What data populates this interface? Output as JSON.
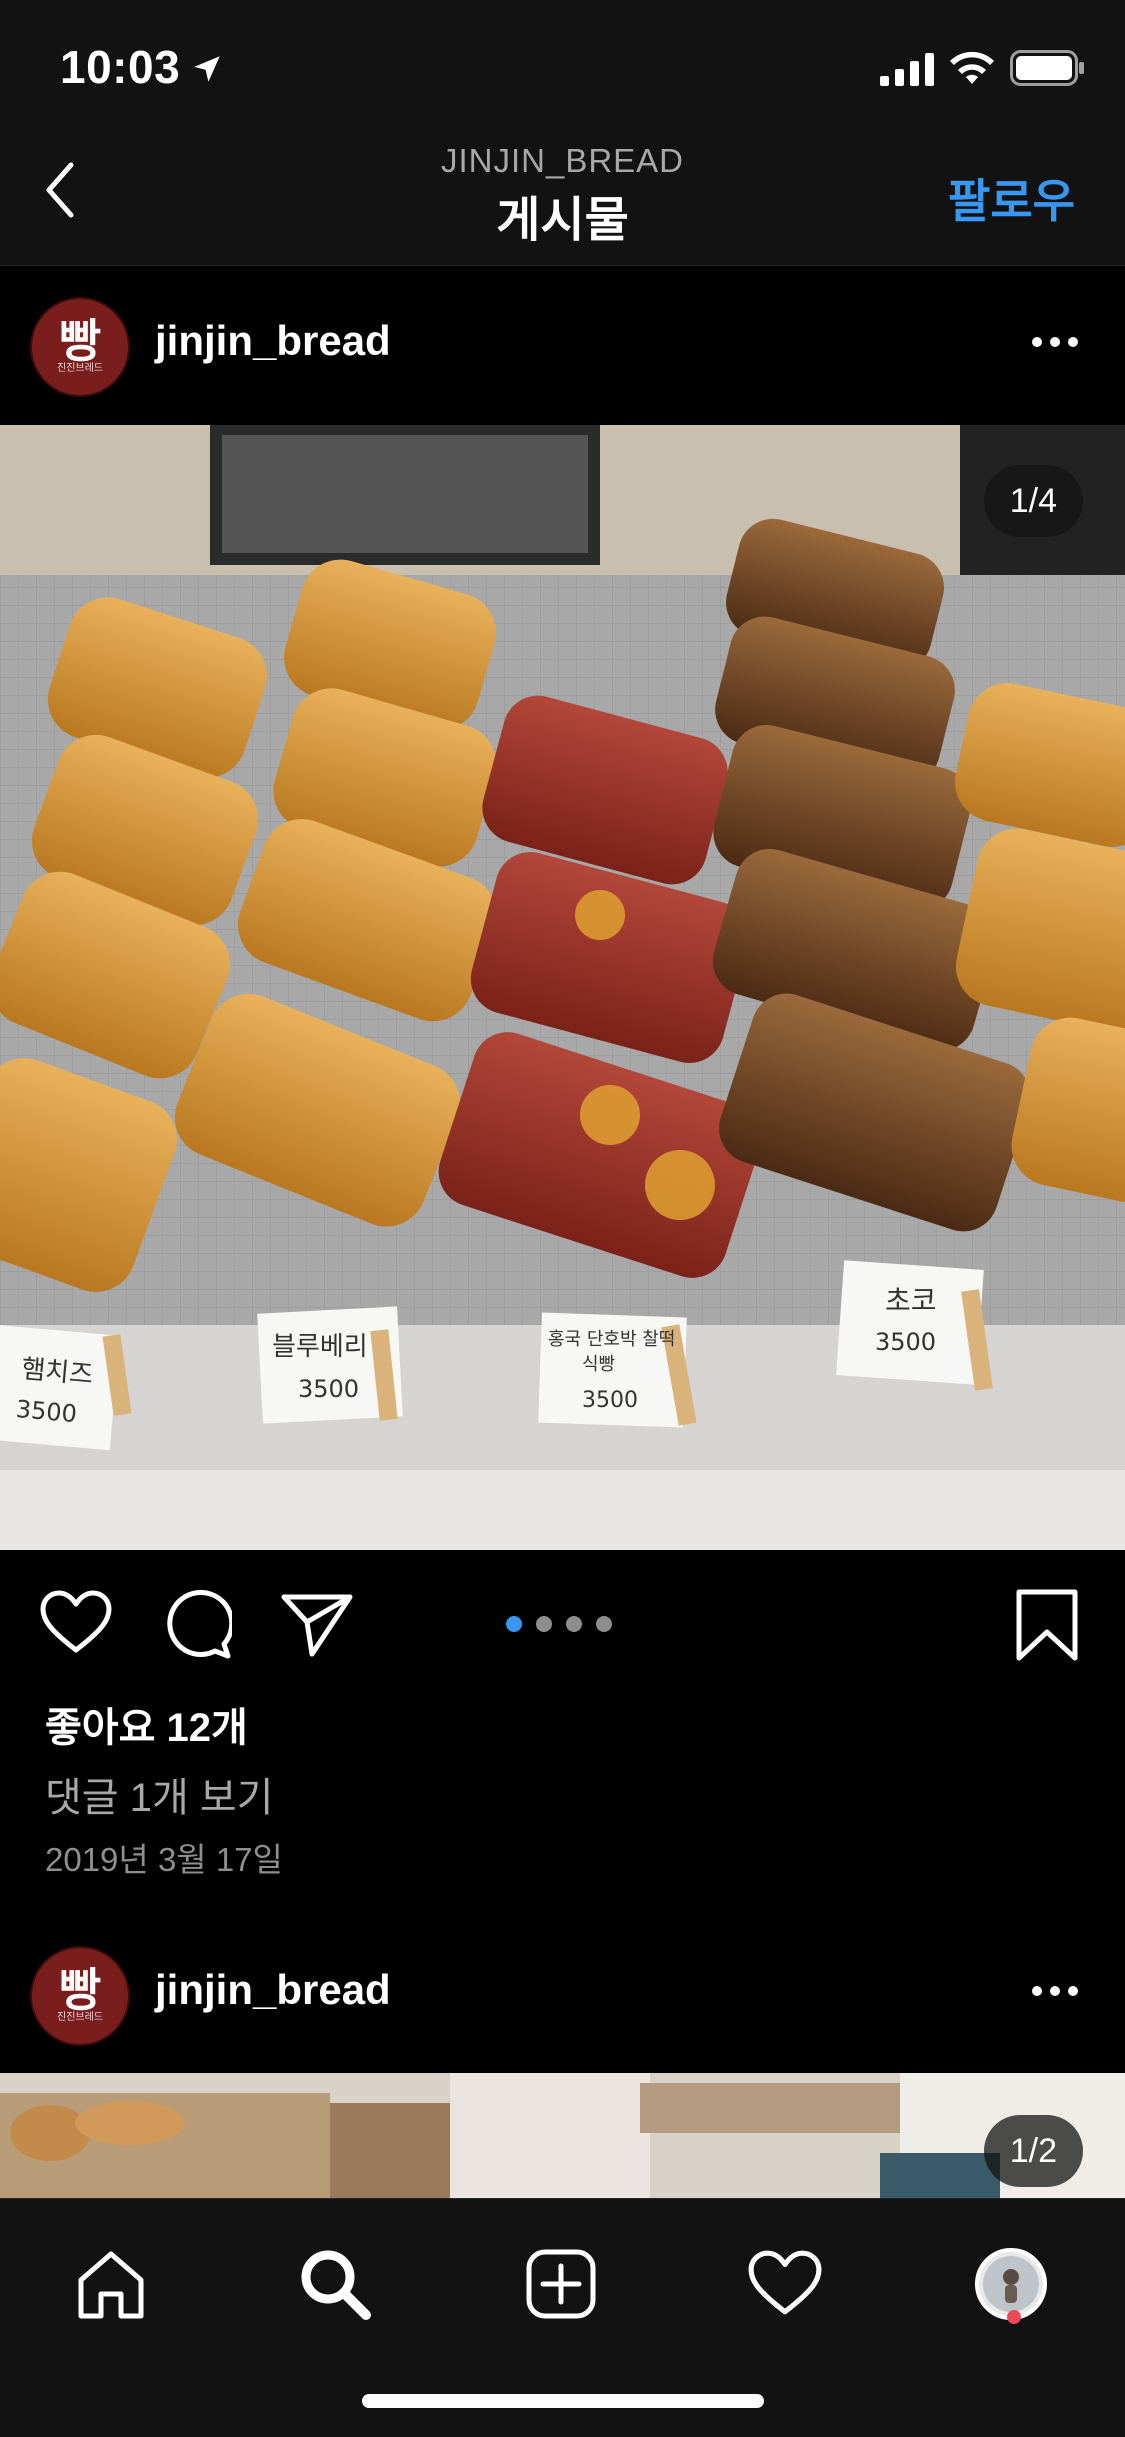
{
  "status_bar": {
    "time": "10:03"
  },
  "nav": {
    "username": "JINJIN_BREAD",
    "title": "게시물",
    "follow_label": "팔로우"
  },
  "post": {
    "username": "jinjin_bread",
    "avatar_text": "빵",
    "avatar_subtext": "진진브레드",
    "image_counter": "1/4",
    "carousel": {
      "total": 4,
      "active": 1
    },
    "price_tags": [
      {
        "name": "햄치즈",
        "price": "3500"
      },
      {
        "name": "블루베리",
        "price": "3500"
      },
      {
        "name": "홍국 단호박 찰떡 식빵",
        "price": "3500"
      },
      {
        "name": "초코",
        "price": "3500"
      }
    ],
    "likes": "좋아요 12개",
    "comments": "댓글 1개 보기",
    "date": "2019년 3월 17일"
  },
  "next_post": {
    "username": "jinjin_bread",
    "avatar_text": "빵",
    "avatar_subtext": "진진브레드",
    "image_counter": "1/2"
  },
  "colors": {
    "accent": "#3897f0",
    "background": "#000000",
    "bar": "#121212",
    "notification": "#ed4956"
  },
  "icons": {
    "actions": [
      "heart-icon",
      "comment-icon",
      "share-icon",
      "bookmark-icon"
    ],
    "tabs": [
      "home-icon",
      "search-icon",
      "add-icon",
      "activity-heart-icon",
      "profile-avatar"
    ]
  }
}
